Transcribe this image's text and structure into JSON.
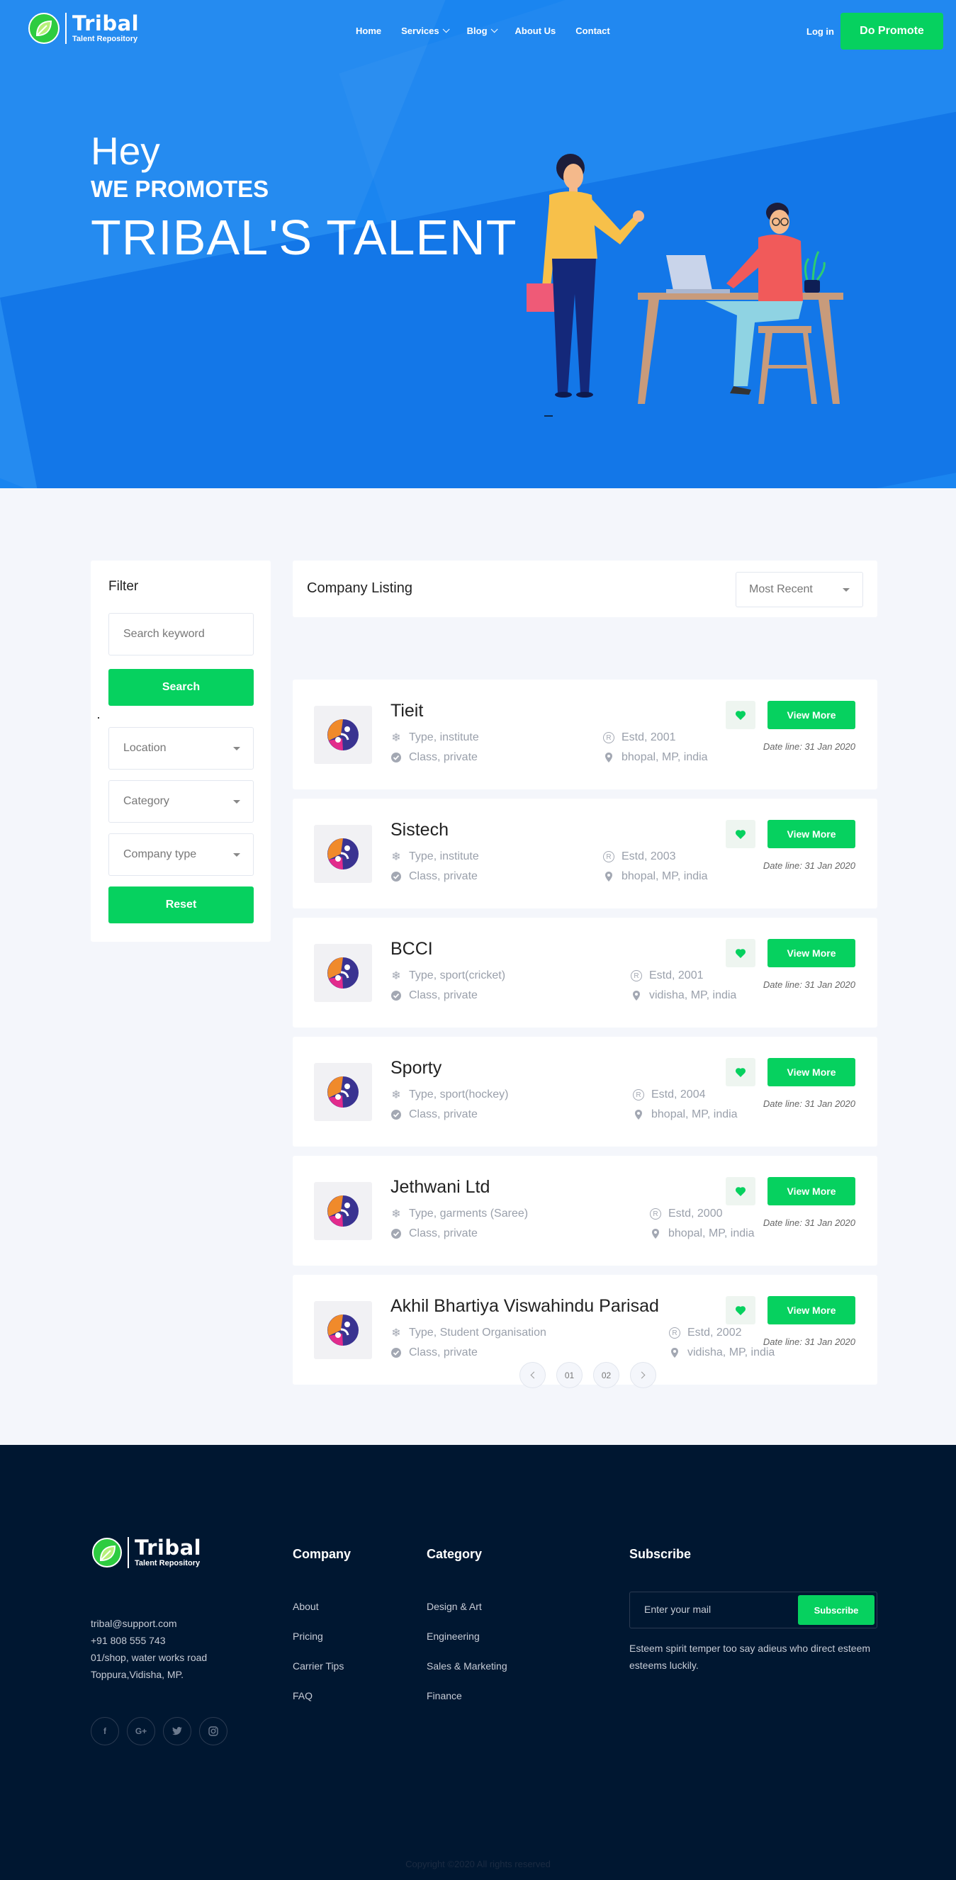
{
  "brand": {
    "name": "Tribal",
    "tagline": "Talent Repository"
  },
  "nav": {
    "links": [
      {
        "label": "Home",
        "has_dropdown": false
      },
      {
        "label": "Services",
        "has_dropdown": true
      },
      {
        "label": "Blog",
        "has_dropdown": true
      },
      {
        "label": "About Us",
        "has_dropdown": false
      },
      {
        "label": "Contact",
        "has_dropdown": false
      }
    ],
    "login": "Log in",
    "promote": "Do Promote"
  },
  "hero": {
    "line1": "Hey",
    "line2": "WE PROMOTES",
    "line3": "TRIBAL'S TALENT"
  },
  "filter": {
    "title": "Filter",
    "search_placeholder": "Search keyword",
    "search_button": "Search",
    "location": "Location",
    "category": "Category",
    "company_type": "Company type",
    "reset_button": "Reset"
  },
  "listing": {
    "title": "Company Listing",
    "sort": "Most Recent",
    "view_more": "View More",
    "companies": [
      {
        "name": "Tieit",
        "type": "Type, institute",
        "estd": "Estd, 2001",
        "class": "Class, private",
        "location": "bhopal, MP, india",
        "date": "Date line: 31 Jan 2020"
      },
      {
        "name": "Sistech",
        "type": "Type, institute",
        "estd": "Estd, 2003",
        "class": "Class, private",
        "location": "bhopal, MP, india",
        "date": "Date line: 31 Jan 2020"
      },
      {
        "name": "BCCI",
        "type": "Type, sport(cricket)",
        "estd": "Estd, 2001",
        "class": "Class, private",
        "location": "vidisha, MP, india",
        "date": "Date line: 31 Jan 2020"
      },
      {
        "name": "Sporty",
        "type": "Type, sport(hockey)",
        "estd": "Estd, 2004",
        "class": "Class, private",
        "location": "bhopal, MP, india",
        "date": "Date line: 31 Jan 2020"
      },
      {
        "name": "Jethwani Ltd",
        "type": "Type, garments (Saree)",
        "estd": "Estd, 2000",
        "class": "Class, private",
        "location": "bhopal, MP, india",
        "date": "Date line: 31 Jan 2020"
      },
      {
        "name": "Akhil Bhartiya Viswahindu Parisad",
        "type": "Type, Student Organisation",
        "estd": "Estd, 2002",
        "class": "Class, private",
        "location": "vidisha, MP, india",
        "date": "Date line: 31 Jan 2020"
      }
    ],
    "pages": [
      "01",
      "02"
    ]
  },
  "footer": {
    "contact": [
      "tribal@support.com",
      "+91 808 555 743",
      "01/shop, water works road",
      "Toppura,Vidisha, MP."
    ],
    "social": [
      "f",
      "G+",
      "twitter-icon",
      "instagram-icon"
    ],
    "company": {
      "title": "Company",
      "links": [
        "About",
        "Pricing",
        "Carrier Tips",
        "FAQ"
      ]
    },
    "category": {
      "title": "Category",
      "links": [
        "Design & Art",
        "Engineering",
        "Sales & Marketing",
        "Finance"
      ]
    },
    "subscribe": {
      "title": "Subscribe",
      "placeholder": "Enter your mail",
      "button": "Subscribe",
      "text": "Esteem spirit temper too say adieus who direct esteem esteems luckily."
    },
    "copyright": "Copyright ©2020 All rights reserved"
  },
  "colors": {
    "primary_blue": "#1a85f0",
    "accent_green": "#06d15f",
    "footer_bg": "#001731"
  }
}
